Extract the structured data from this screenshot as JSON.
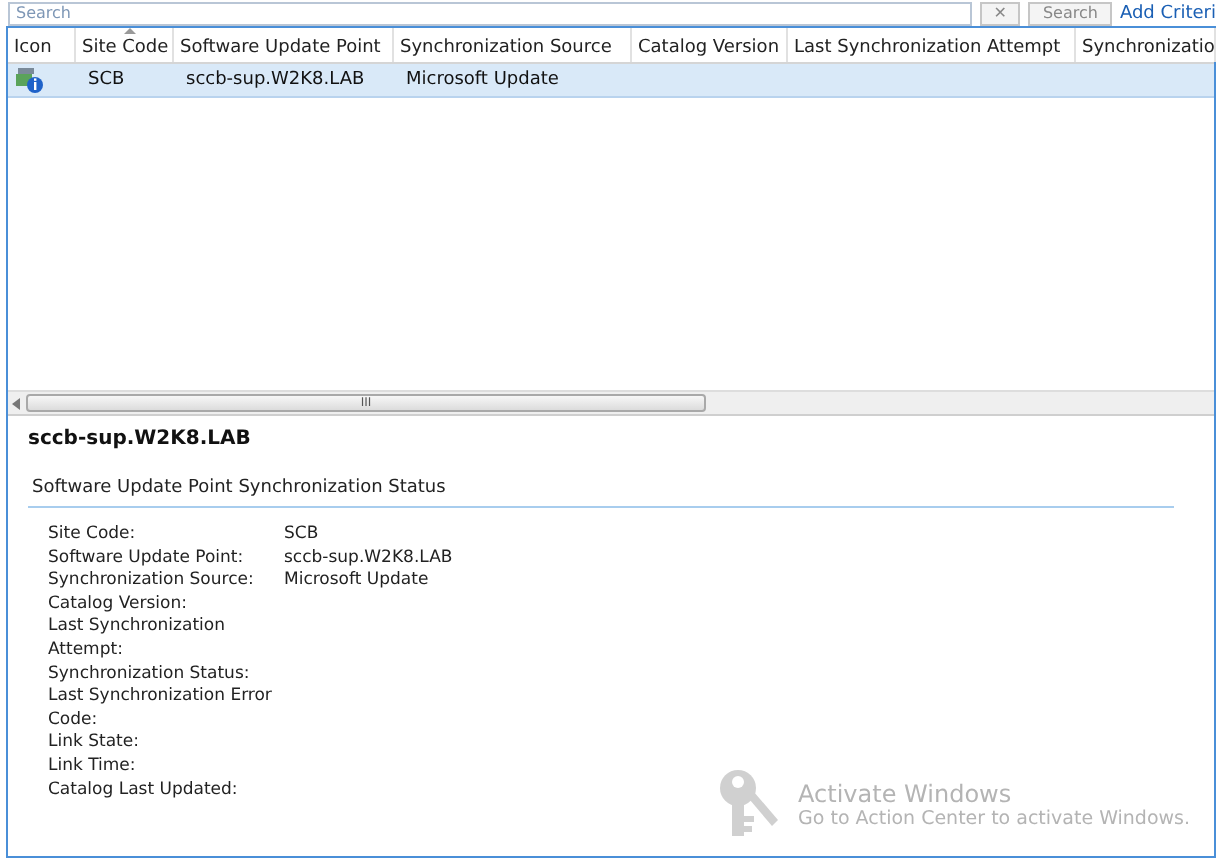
{
  "search_bar": {
    "placeholder": "Search",
    "clear_button": "✕",
    "search_button": "Search",
    "add_criteria_link": "Add Criteri"
  },
  "table": {
    "columns": [
      {
        "label": "Icon",
        "sorted": false
      },
      {
        "label": "Site Code",
        "sorted": true
      },
      {
        "label": "Software Update Point",
        "sorted": false
      },
      {
        "label": "Synchronization Source",
        "sorted": false
      },
      {
        "label": "Catalog Version",
        "sorted": false
      },
      {
        "label": "Last Synchronization Attempt",
        "sorted": false
      },
      {
        "label": "Synchronizatio",
        "sorted": false
      }
    ],
    "rows": [
      {
        "selected": true,
        "cells": [
          "",
          "SCB",
          "sccb-sup.W2K8.LAB",
          "Microsoft Update"
        ]
      }
    ],
    "scrollbar_grip": "III"
  },
  "details": {
    "title": "sccb-sup.W2K8.LAB",
    "section": "Software Update Point Synchronization Status",
    "fields": [
      {
        "label": "Site Code:",
        "value": "SCB"
      },
      {
        "label": "Software Update Point:",
        "value": "sccb-sup.W2K8.LAB"
      },
      {
        "label": "Synchronization Source:",
        "value": "Microsoft Update"
      },
      {
        "label": "Catalog Version:"
      },
      {
        "label": "Last Synchronization\nAttempt:"
      },
      {
        "label": "Synchronization Status:"
      },
      {
        "label": "Last Synchronization Error\nCode:"
      },
      {
        "label": "Link State:"
      },
      {
        "label": "Link Time:"
      },
      {
        "label": "Catalog Last Updated:"
      }
    ]
  },
  "activation_notice": {
    "title": "Activate Windows",
    "message": "Go to Action Center to activate Windows."
  }
}
